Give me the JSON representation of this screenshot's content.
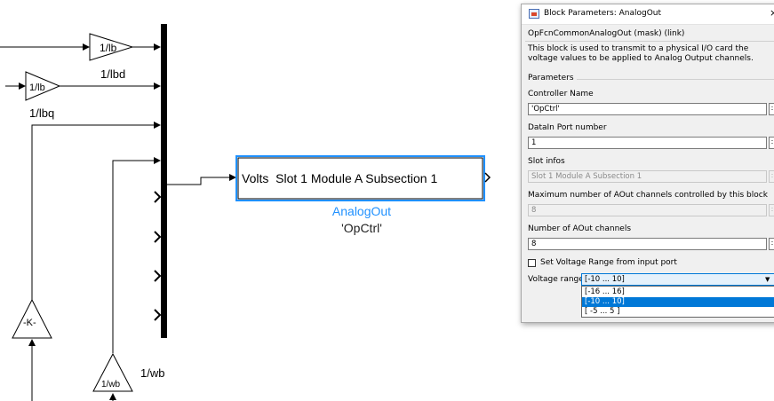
{
  "diagram": {
    "gain_blocks": [
      {
        "label": "1/lb"
      },
      {
        "label": "1/lb"
      },
      {
        "label": "-K-"
      },
      {
        "label": "1/wb"
      }
    ],
    "signal_labels": {
      "lbd": "1/lbd",
      "lbq": "1/lbq",
      "wb": "1/wb"
    },
    "analog_out_block": {
      "text": "Volts  Slot 1 Module A Subsection 1",
      "name": "AnalogOut",
      "param": "'OpCtrl'"
    },
    "colors": {
      "block_border": "#1e90ff",
      "block_name": "#1e90ff",
      "line": "#000000"
    }
  },
  "dialog": {
    "title": "Block Parameters: AnalogOut",
    "mask_title": "OpFcnCommonAnalogOut (mask) (link)",
    "description": "This block is used to transmit to a physical I/O card the voltage values to be applied to Analog Output channels.",
    "group_label": "Parameters",
    "controller_name_label": "Controller Name",
    "controller_name_value": "'OpCtrl'",
    "datain_port_label": "DataIn Port number",
    "datain_port_value": "1",
    "slot_infos_label": "Slot infos",
    "slot_infos_value": "Slot 1 Module A Subsection 1",
    "max_channels_label": "Maximum number of AOut channels controlled by this block",
    "max_channels_value": "8",
    "num_channels_label": "Number of AOut channels",
    "num_channels_value": "8",
    "checkbox_label": "Set Voltage Range from input port",
    "checkbox_checked": false,
    "voltage_range_label": "Voltage range",
    "voltage_range_value": "[-10 ... 10]",
    "voltage_range_options": [
      "[-16 ... 16]",
      "[-10 ... 10]",
      "[ -5 ... 5 ]"
    ],
    "voltage_range_selected_index": 1,
    "more_button": ":",
    "close_glyph": "×",
    "dropdown_arrow": "▼"
  }
}
